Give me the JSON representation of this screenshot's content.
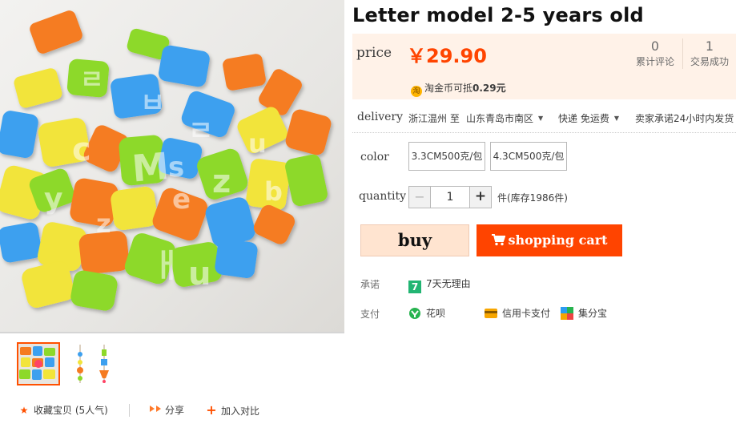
{
  "product": {
    "title": "Letter model  2-5 years old"
  },
  "price": {
    "label": "price",
    "value": "￥29.90",
    "reviews_count": "0",
    "reviews_label": "累计评论",
    "deals_count": "1",
    "deals_label": "交易成功",
    "coin_icon": "淘",
    "coin_text": "淘金币可抵",
    "coin_value": "0.29元"
  },
  "delivery": {
    "label": "delivery",
    "from": "浙江温州 至",
    "to": "山东青岛市南区",
    "shipping": "快递 免运费",
    "promise": "卖家承诺24小时内发货"
  },
  "color": {
    "label": "color",
    "options": [
      "3.3CM500克/包",
      "4.3CM500克/包"
    ]
  },
  "quantity": {
    "label": "quantity",
    "minus": "−",
    "value": "1",
    "plus": "+",
    "stock": "件(库存1986件)"
  },
  "actions": {
    "buy": "buy",
    "cart": "shopping cart"
  },
  "services": {
    "promise_label": "承诺",
    "seven_day_icon": "7",
    "seven_day": "7天无理由",
    "pay_label": "支付",
    "huabei": "花呗",
    "credit": "信用卡支付",
    "jifenbao": "集分宝"
  },
  "social": {
    "favorite": "收藏宝贝 (5人气)",
    "share": "分享",
    "compare": "加入对比"
  },
  "icons": [
    "star-icon",
    "share-icon",
    "plus-icon",
    "cart-icon",
    "coin-icon",
    "seven-day-icon",
    "huabei-icon",
    "credit-card-icon",
    "jifenbao-icon",
    "chevron-down-icon"
  ],
  "colors": {
    "accent": "#ff4400",
    "price_bg": "#fff2e8",
    "buy_bg": "#ffe4d0"
  }
}
